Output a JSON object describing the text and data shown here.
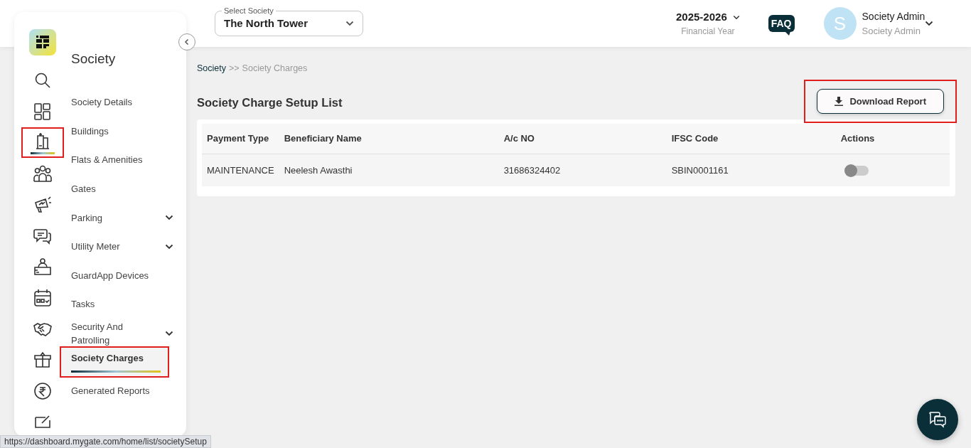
{
  "sidebar": {
    "rail": [
      {
        "kind": "search",
        "selected": false,
        "highlighted": false
      },
      {
        "kind": "grid",
        "selected": false,
        "highlighted": false
      },
      {
        "kind": "building",
        "selected": true,
        "highlighted": true
      },
      {
        "kind": "people",
        "selected": false,
        "highlighted": false
      },
      {
        "kind": "megaphone",
        "selected": false,
        "highlighted": false
      },
      {
        "kind": "chat",
        "selected": false,
        "highlighted": false
      },
      {
        "kind": "desk",
        "selected": false,
        "highlighted": false
      },
      {
        "kind": "calendar",
        "selected": false,
        "highlighted": false
      },
      {
        "kind": "handshake",
        "selected": false,
        "highlighted": false
      },
      {
        "kind": "box",
        "selected": false,
        "highlighted": false
      },
      {
        "kind": "rupee",
        "selected": false,
        "highlighted": false
      },
      {
        "kind": "edit",
        "selected": false,
        "highlighted": false
      }
    ],
    "section_title": "Society",
    "items": [
      {
        "label": "Society Details",
        "selected": false,
        "expandable": false,
        "highlighted": false
      },
      {
        "label": "Buildings",
        "selected": false,
        "expandable": false,
        "highlighted": false
      },
      {
        "label": "Flats & Amenities",
        "selected": false,
        "expandable": false,
        "highlighted": false
      },
      {
        "label": "Gates",
        "selected": false,
        "expandable": false,
        "highlighted": false
      },
      {
        "label": "Parking",
        "selected": false,
        "expandable": true,
        "highlighted": false
      },
      {
        "label": "Utility Meter",
        "selected": false,
        "expandable": true,
        "highlighted": false
      },
      {
        "label": "GuardApp Devices",
        "selected": false,
        "expandable": false,
        "highlighted": false
      },
      {
        "label": "Tasks",
        "selected": false,
        "expandable": false,
        "highlighted": false
      },
      {
        "label": "Security And Patrolling",
        "selected": false,
        "expandable": true,
        "highlighted": false
      },
      {
        "label": "Society Charges",
        "selected": true,
        "expandable": false,
        "highlighted": true
      },
      {
        "label": "Generated Reports",
        "selected": false,
        "expandable": false,
        "highlighted": false
      }
    ]
  },
  "header": {
    "society_select": {
      "label": "Select Society",
      "value": "The North Tower"
    },
    "year": {
      "value": "2025-2026",
      "caption": "Financial Year"
    },
    "faq": "FAQ",
    "user": {
      "initial": "S",
      "name": "Society Admin",
      "role": "Society Admin"
    }
  },
  "breadcrumb": {
    "root": "Society",
    "separator": ">>",
    "current": "Society Charges"
  },
  "page_title": "Society Charge Setup List",
  "download_button": {
    "label": "Download Report",
    "highlighted": true
  },
  "table": {
    "columns": [
      "Payment Type",
      "Beneficiary Name",
      "A/c NO",
      "IFSC Code",
      "Actions"
    ],
    "rows": [
      {
        "cells": [
          "MAINTENANCE",
          "Neelesh Awasthi",
          "31686324402",
          "SBIN0001161"
        ],
        "on": false
      }
    ]
  },
  "status_url": "https://dashboard.mygate.com/home/list/societySetup"
}
